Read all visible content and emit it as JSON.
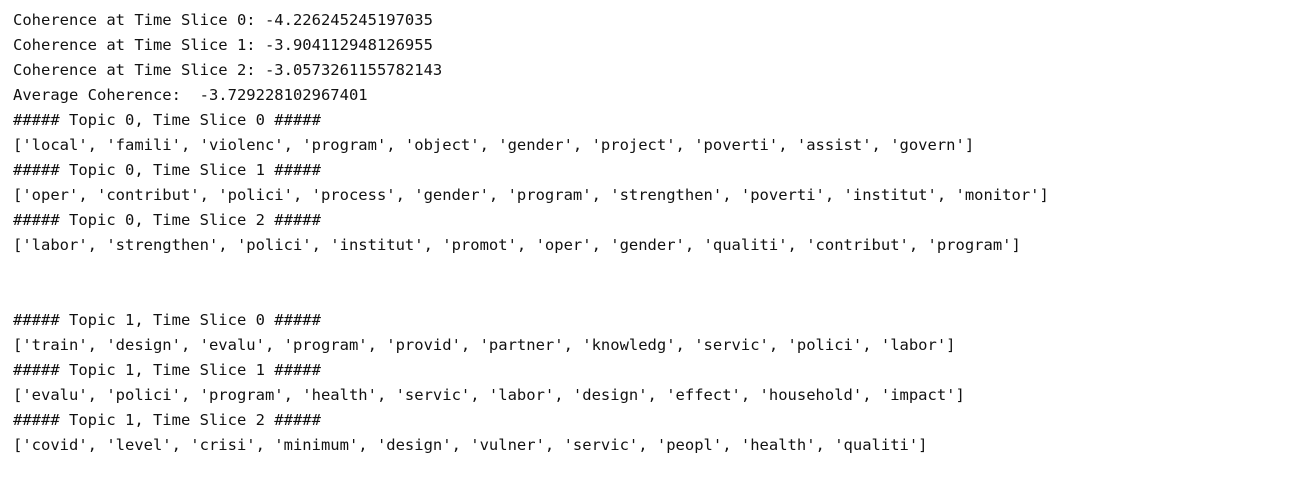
{
  "output": {
    "coherence": [
      "Coherence at Time Slice 0: -4.226245245197035",
      "Coherence at Time Slice 1: -3.904112948126955",
      "Coherence at Time Slice 2: -3.0573261155782143"
    ],
    "average": "Average Coherence:  -3.729228102967401",
    "topic0": [
      "##### Topic 0, Time Slice 0 #####",
      "['local', 'famili', 'violenc', 'program', 'object', 'gender', 'project', 'poverti', 'assist', 'govern']",
      "##### Topic 0, Time Slice 1 #####",
      "['oper', 'contribut', 'polici', 'process', 'gender', 'program', 'strengthen', 'poverti', 'institut', 'monitor']",
      "##### Topic 0, Time Slice 2 #####",
      "['labor', 'strengthen', 'polici', 'institut', 'promot', 'oper', 'gender', 'qualiti', 'contribut', 'program']"
    ],
    "topic1": [
      "##### Topic 1, Time Slice 0 #####",
      "['train', 'design', 'evalu', 'program', 'provid', 'partner', 'knowledg', 'servic', 'polici', 'labor']",
      "##### Topic 1, Time Slice 1 #####",
      "['evalu', 'polici', 'program', 'health', 'servic', 'labor', 'design', 'effect', 'household', 'impact']",
      "##### Topic 1, Time Slice 2 #####",
      "['covid', 'level', 'crisi', 'minimum', 'design', 'vulner', 'servic', 'peopl', 'health', 'qualiti']"
    ]
  }
}
